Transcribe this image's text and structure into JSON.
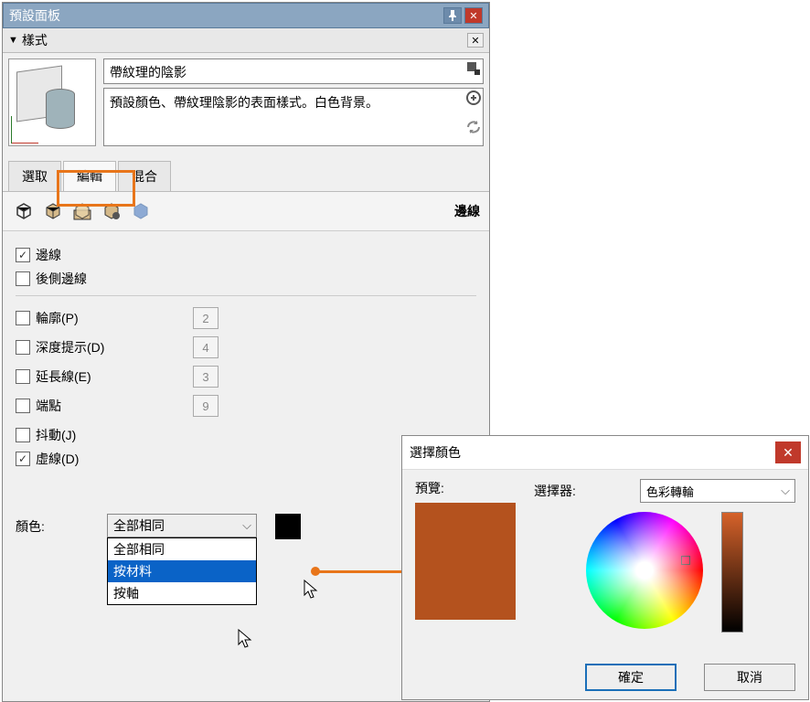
{
  "panel": {
    "title": "預設面板",
    "subtitle": "樣式",
    "style_name": "帶紋理的陰影",
    "style_desc": "預設顏色、帶紋理陰影的表面樣式。白色背景。"
  },
  "tabs": {
    "select": "選取",
    "edit": "編輯",
    "mix": "混合"
  },
  "icon_row_label": "邊線",
  "checks": {
    "edges": "邊線",
    "back_edges": "後側邊線",
    "profiles": "輪廓(P)",
    "depth_cue": "深度提示(D)",
    "extension": "延長線(E)",
    "endpoints": "端點",
    "jitter": "抖動(J)",
    "dashes": "虛線(D)"
  },
  "values": {
    "profiles": "2",
    "depth_cue": "4",
    "extension": "3",
    "endpoints": "9"
  },
  "color_label": "顏色:",
  "combo_value": "全部相同",
  "dropdown": {
    "opt1": "全部相同",
    "opt2": "按材料",
    "opt3": "按軸"
  },
  "dialog": {
    "title": "選擇顏色",
    "preview_label": "預覽:",
    "picker_label": "選擇器:",
    "picker_value": "色彩轉輪",
    "ok": "確定",
    "cancel": "取消"
  },
  "colors": {
    "accent": "#e8751a",
    "swatch": "#000000",
    "preview": "#b4521e"
  }
}
